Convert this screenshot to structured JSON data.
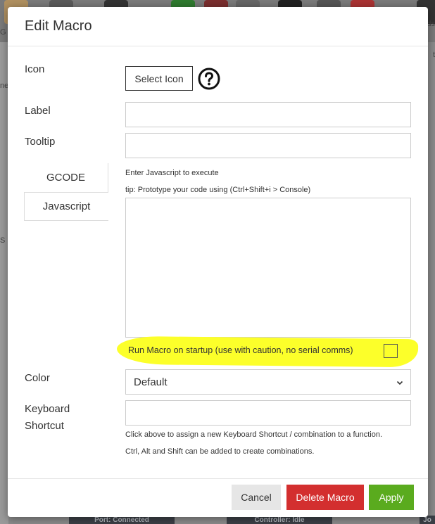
{
  "dialog": {
    "title": "Edit Macro"
  },
  "form": {
    "icon_label": "Icon",
    "select_icon_button": "Select Icon",
    "label_label": "Label",
    "label_value": "",
    "tooltip_label": "Tooltip",
    "tooltip_value": "",
    "tabs": [
      {
        "label": "GCODE",
        "active": false
      },
      {
        "label": "Javascript",
        "active": true
      }
    ],
    "js_hint": "Enter Javascript to execute",
    "js_tip": "tip: Prototype your code using (Ctrl+Shift+i > Console)",
    "code_value": "",
    "startup_label": "Run Macro on startup (use with caution, no serial comms)",
    "startup_checked": false,
    "color_label": "Color",
    "color_selected": "Default",
    "shortcut_label_line1": "Keyboard",
    "shortcut_label_line2": "Shortcut",
    "shortcut_value": "",
    "shortcut_help_line1": "Click above to assign a new Keyboard Shortcut / combination to a function.",
    "shortcut_help_line2": "Ctrl, Alt and Shift can be added to create combinations."
  },
  "footer": {
    "cancel": "Cancel",
    "delete": "Delete Macro",
    "apply": "Apply"
  },
  "background": {
    "left_fragments": [
      "G",
      "ne",
      "S"
    ],
    "right_fragments": [
      "ds",
      "t"
    ],
    "status_port": "Port: Connected",
    "status_controller": "Controller: Idle",
    "status_right": "Jo"
  },
  "colors": {
    "delete": "#d32f2f",
    "apply": "#5aab1e",
    "highlight": "#fcff2a"
  }
}
